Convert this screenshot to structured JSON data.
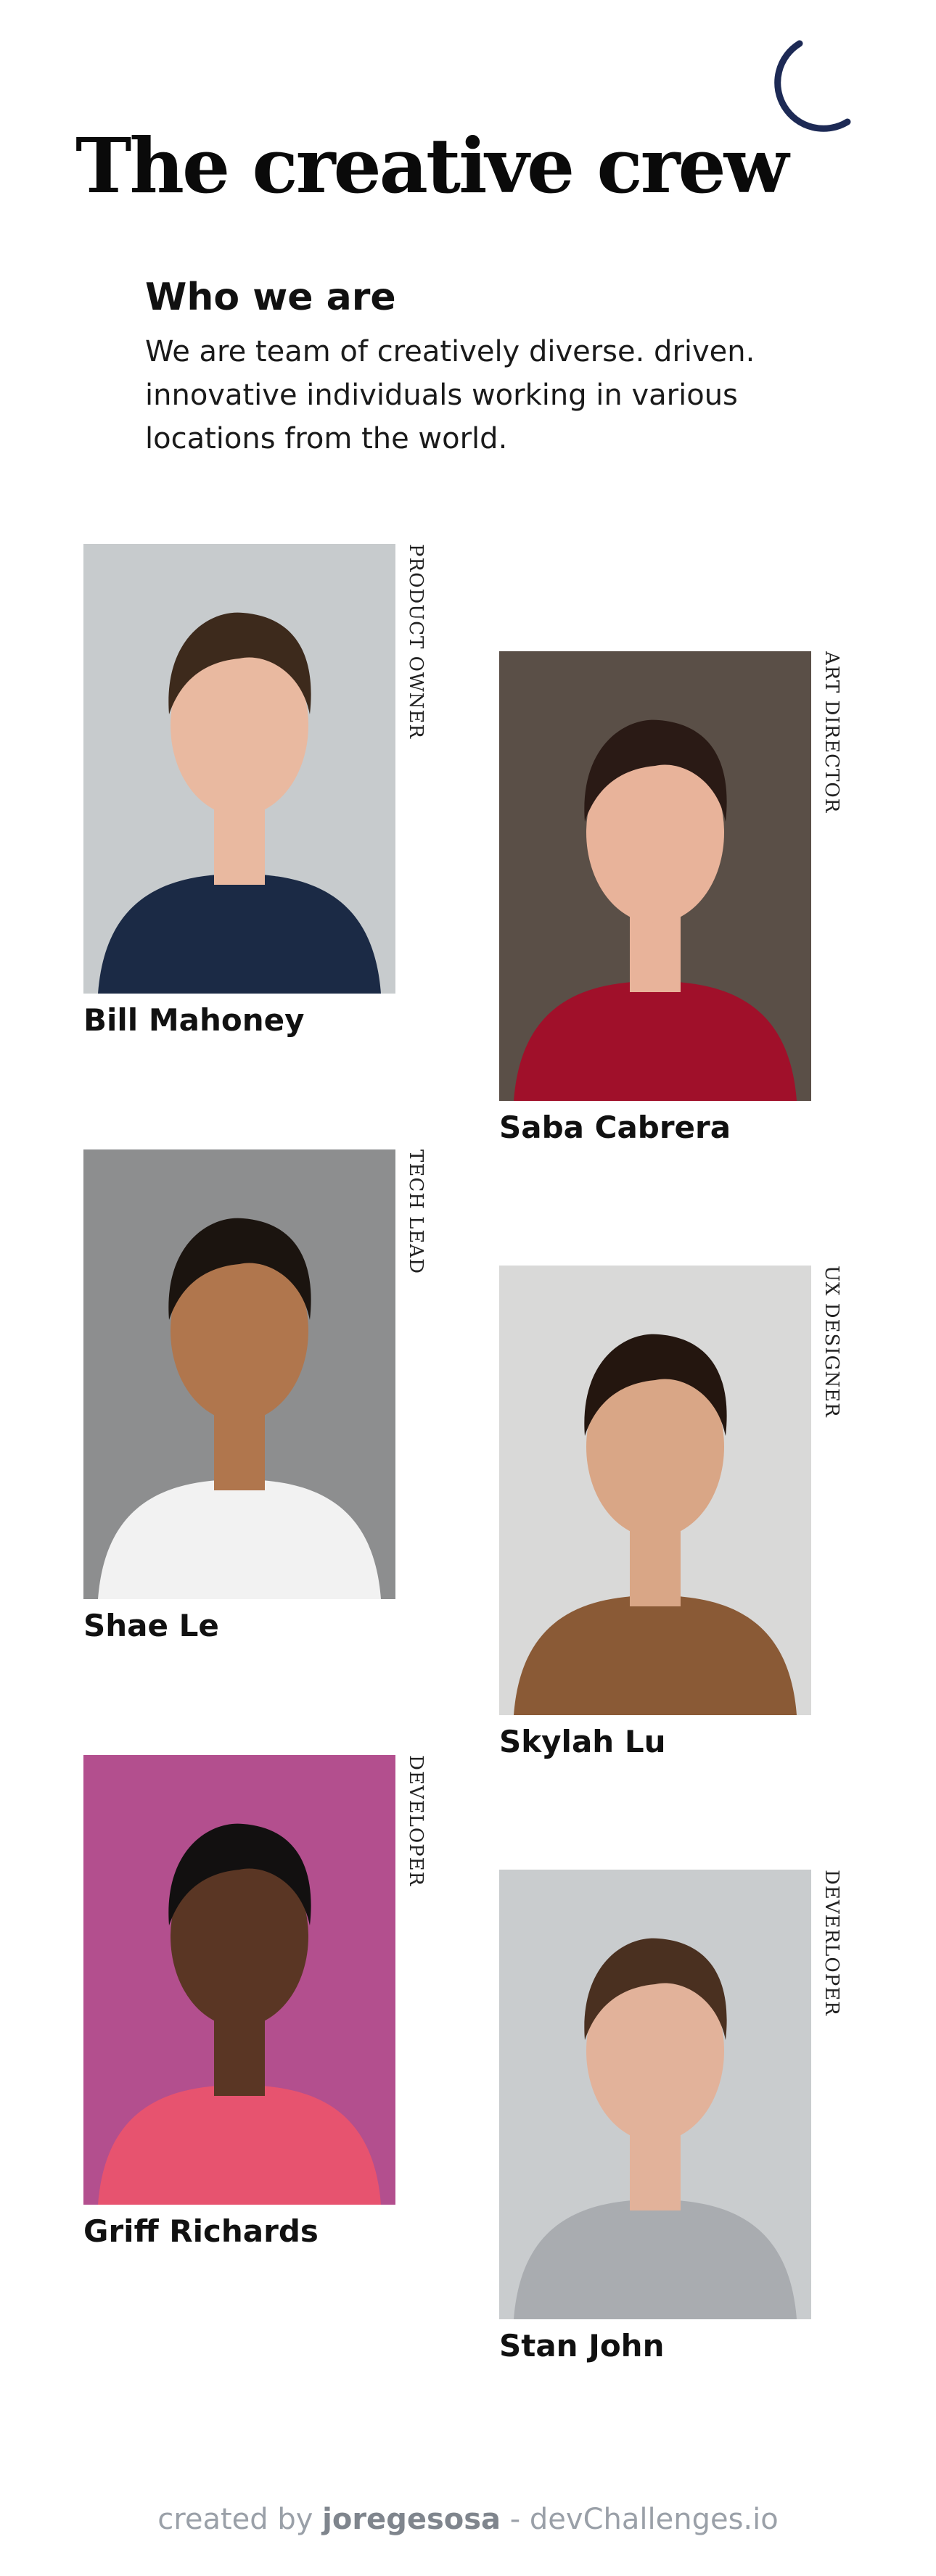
{
  "header": {
    "title": "The creative crew",
    "theme_toggle_icon": "moon-icon"
  },
  "intro": {
    "heading": "Who we are",
    "text": "We are team of creatively diverse. driven. innovative individuals working in various locations from the world."
  },
  "team": [
    {
      "name": "Bill Mahoney",
      "role": "PRODUCT OWNER",
      "colors": {
        "bg": "#c7cbcd",
        "hair": "#3d2a1c",
        "skin": "#e9b9a0",
        "shirt": "#1b2a45"
      }
    },
    {
      "name": "Saba Cabrera",
      "role": "ART DIRECTOR",
      "colors": {
        "bg": "#5a4f47",
        "hair": "#2a1a15",
        "skin": "#e8b39a",
        "shirt": "#a0102a"
      }
    },
    {
      "name": "Shae Le",
      "role": "TECH LEAD",
      "colors": {
        "bg": "#8d8e8f",
        "hair": "#1b140f",
        "skin": "#b0764d",
        "shirt": "#f2f2f2"
      }
    },
    {
      "name": "Skylah Lu",
      "role": "UX DESIGNER",
      "colors": {
        "bg": "#d9d9d8",
        "hair": "#24160f",
        "skin": "#d9a686",
        "shirt": "#8a5a36"
      }
    },
    {
      "name": "Griff Richards",
      "role": "DEVELOPER",
      "colors": {
        "bg": "#b34f8e",
        "hair": "#121010",
        "skin": "#5a3624",
        "shirt": "#e7536f"
      }
    },
    {
      "name": "Stan John",
      "role": "DEVERLOPER",
      "colors": {
        "bg": "#c9ccce",
        "hair": "#4a3020",
        "skin": "#e2b29a",
        "shirt": "#a9acb0"
      }
    }
  ],
  "footer": {
    "prefix": "created by ",
    "author": "joregesosa",
    "suffix": " - devChallenges.io"
  }
}
